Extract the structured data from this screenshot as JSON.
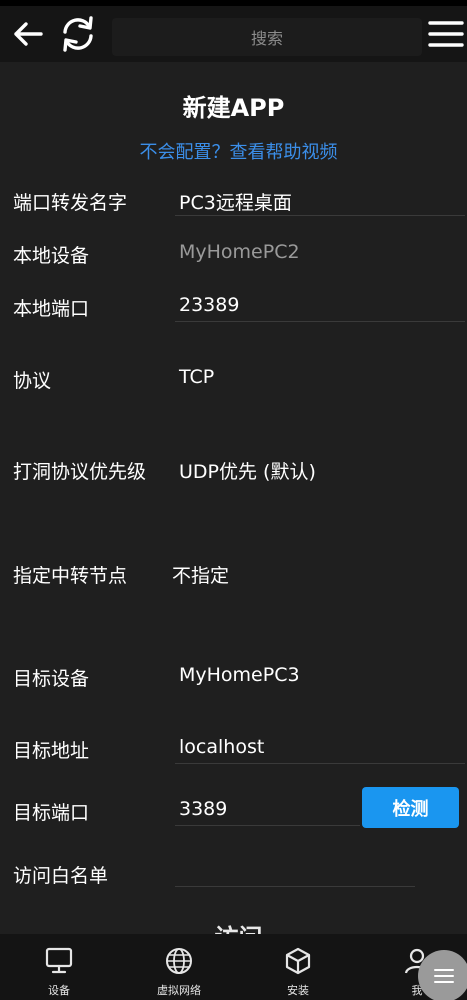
{
  "header": {
    "search_placeholder": "搜索"
  },
  "form": {
    "title": "新建APP",
    "help_link": "不会配置？查看帮助视频",
    "rows": [
      {
        "label": "端口转发名字",
        "value": "PC3远程桌面"
      },
      {
        "label": "本地设备",
        "value": "MyHomePC2"
      },
      {
        "label": "本地端口",
        "value": "23389"
      },
      {
        "label": "协议",
        "value": "TCP"
      },
      {
        "label": "打洞协议优先级",
        "value": "UDP优先 (默认)"
      },
      {
        "label": "指定中转节点",
        "value": "不指定"
      },
      {
        "label": "目标设备",
        "value": "MyHomePC3"
      },
      {
        "label": "目标地址",
        "value": "localhost"
      },
      {
        "label": "目标端口",
        "value": "3389"
      },
      {
        "label": "访问白名单",
        "value": ""
      }
    ],
    "check_button": "检测",
    "next_section_partial": "访问"
  },
  "bottom_nav": {
    "items": [
      {
        "label": "设备",
        "icon": "monitor-icon"
      },
      {
        "label": "虚拟网络",
        "icon": "globe-icon"
      },
      {
        "label": "安装",
        "icon": "box-icon"
      },
      {
        "label": "我",
        "icon": "user-icon"
      }
    ]
  },
  "colors": {
    "background": "#1f1f1f",
    "accent_link": "#3b8ee8",
    "button_blue": "#1a96f0"
  }
}
